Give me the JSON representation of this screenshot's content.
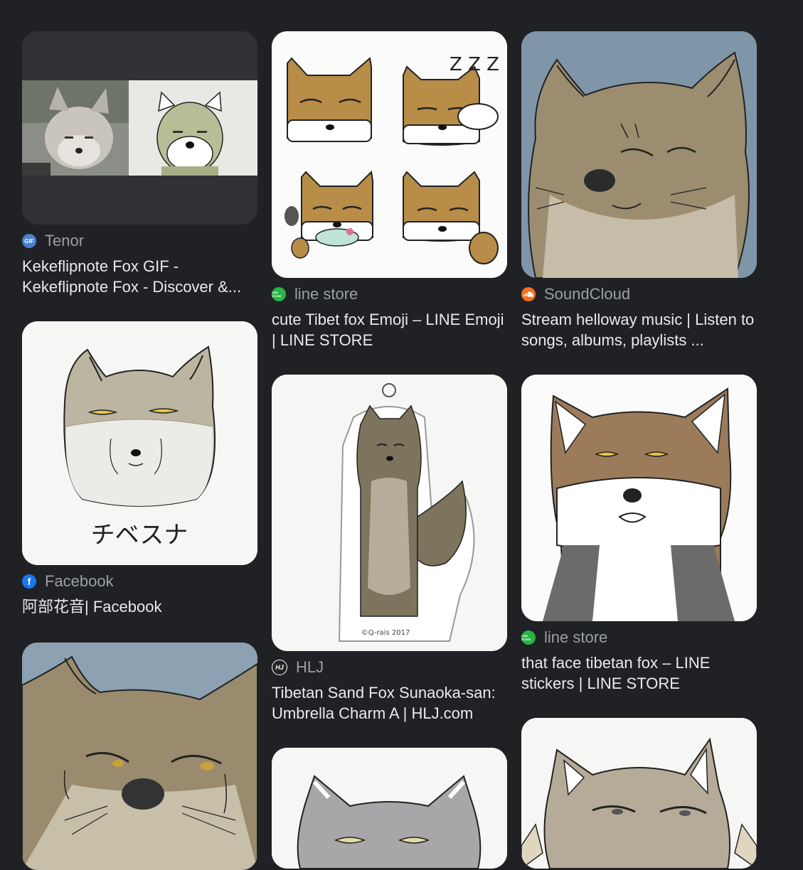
{
  "results": [
    {
      "source": "Tenor",
      "title": "Kekeflipnote Fox GIF - Kekeflipnote Fox - Discover &...",
      "icon": "gif-icon",
      "icon_color": "#4a7fd1"
    },
    {
      "source": "line store",
      "title": "cute Tibet fox Emoji – LINE Emoji | LINE STORE",
      "icon": "line-store-icon",
      "icon_color": "#28b446",
      "icon_text": "LINE STORE"
    },
    {
      "source": "SoundCloud",
      "title": "Stream helloway music | Listen to songs, albums, playlists ...",
      "icon": "soundcloud-icon",
      "icon_color": "#f26f23"
    },
    {
      "source": "Facebook",
      "title": "阿部花音| Facebook",
      "icon": "facebook-icon",
      "icon_color": "#1877f2"
    },
    {
      "source": "HLJ",
      "title": "Tibetan Sand Fox Sunaoka-san: Umbrella Charm A | HLJ.com",
      "icon": "hlj-icon",
      "icon_color": "#222222"
    },
    {
      "source": "line store",
      "title": "that face tibetan fox – LINE stickers | LINE STORE",
      "icon": "line-store-icon",
      "icon_color": "#28b446",
      "icon_text": "LINE STORE"
    }
  ],
  "image_text": {
    "chibesuna": "チベスナ",
    "zzz": "Z Z Z",
    "copyright": "©Q-rais 2017",
    "gif_badge": "GIF"
  }
}
